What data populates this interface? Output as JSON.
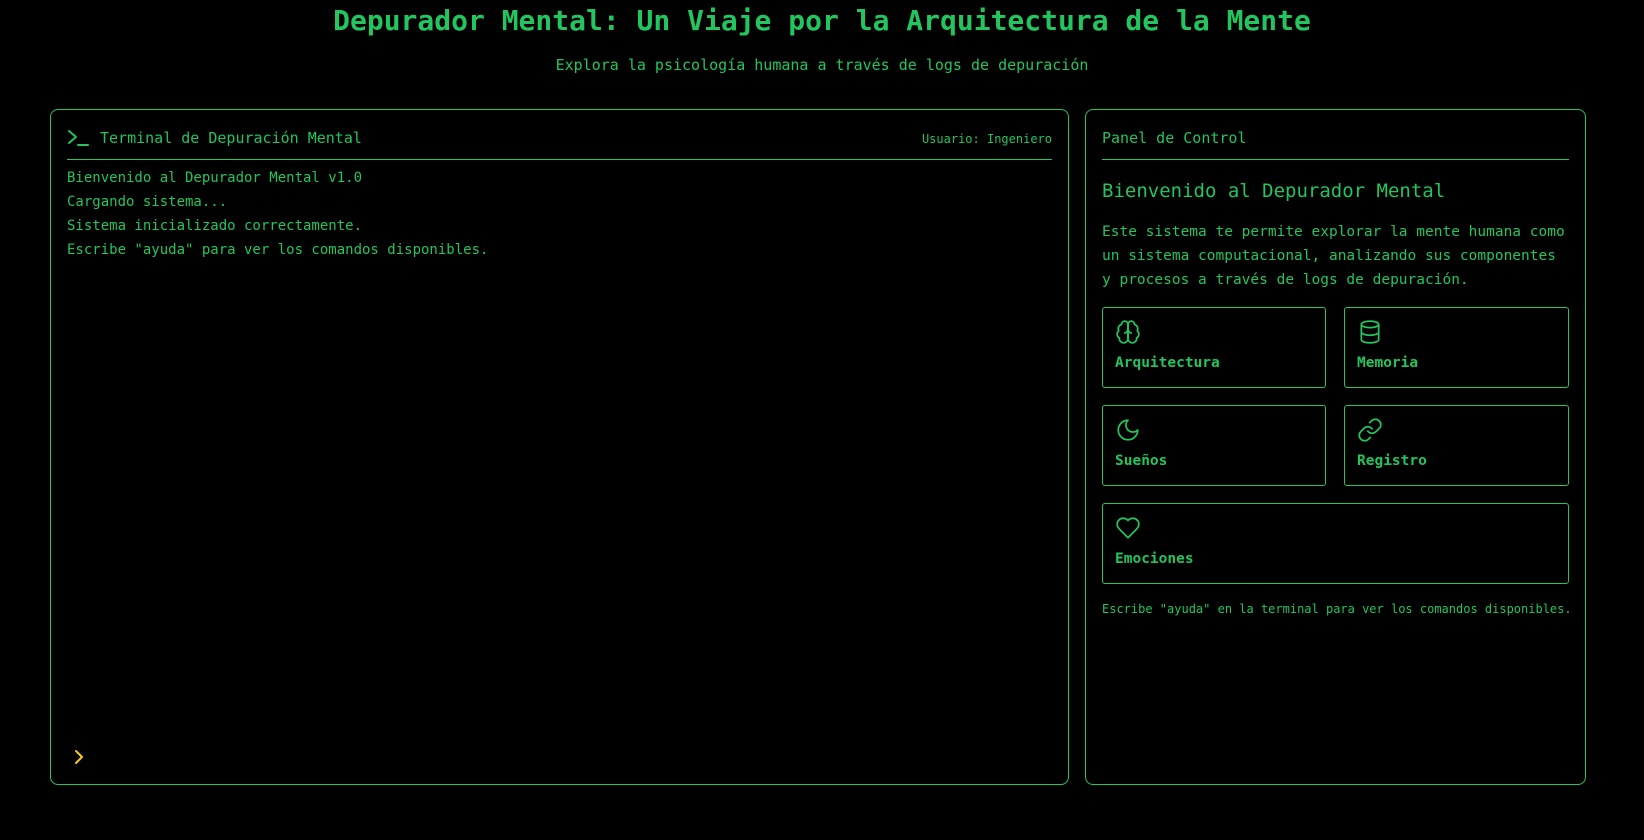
{
  "header": {
    "title": "Depurador Mental: Un Viaje por la Arquitectura de la Mente",
    "subtitle": "Explora la psicología humana a través de logs de depuración"
  },
  "terminal": {
    "icon": "terminal-icon",
    "title": "Terminal de Depuración Mental",
    "user": "Usuario: Ingeniero",
    "lines": [
      "Bienvenido al Depurador Mental v1.0",
      "Cargando sistema...",
      "Sistema inicializado correctamente.",
      "Escribe \"ayuda\" para ver los comandos disponibles."
    ],
    "prompt_icon": "chevron-right-icon",
    "prompt_color": "#facc15",
    "input_value": ""
  },
  "control": {
    "title": "Panel de Control",
    "welcome_title": "Bienvenido al Depurador Mental",
    "welcome_text": "Este sistema te permite explorar la mente humana como un sistema computacional, analizando sus componentes y procesos a través de logs de depuración.",
    "cards": [
      {
        "label": "Arquitectura",
        "icon": "brain-icon"
      },
      {
        "label": "Memoria",
        "icon": "database-icon"
      },
      {
        "label": "Sueños",
        "icon": "moon-icon"
      },
      {
        "label": "Registro",
        "icon": "link-icon"
      },
      {
        "label": "Emociones",
        "icon": "heart-icon"
      }
    ],
    "hint": "Escribe \"ayuda\" en la terminal para ver los comandos disponibles."
  },
  "colors": {
    "accent": "#22c55e",
    "background": "#000000",
    "prompt": "#facc15"
  }
}
